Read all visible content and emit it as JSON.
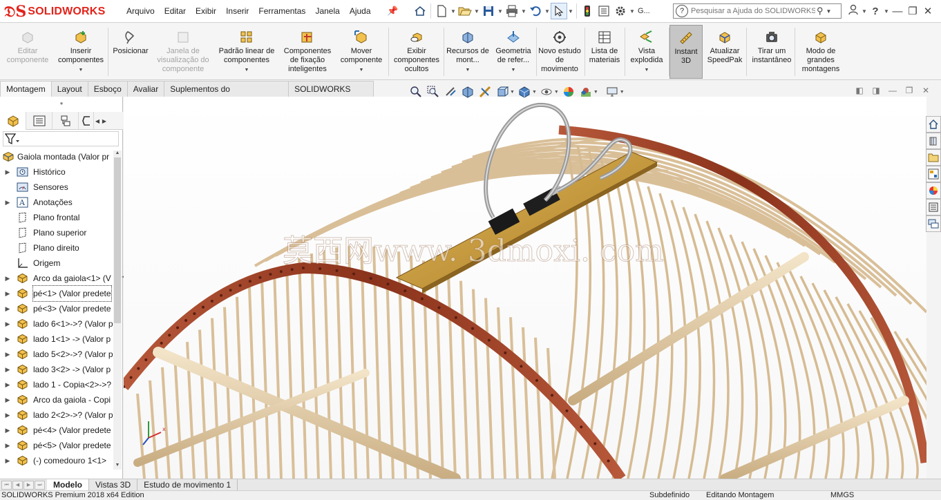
{
  "app": {
    "brand": "SOLIDWORKS",
    "accent_color": "#e2231a"
  },
  "menu": [
    "Arquivo",
    "Editar",
    "Exibir",
    "Inserir",
    "Ferramentas",
    "Janela",
    "Ajuda"
  ],
  "quick_toolbar": {
    "icons": [
      "home-icon",
      "new-doc-icon",
      "open-icon",
      "save-icon",
      "print-icon",
      "undo-icon",
      "select-icon",
      "rebuild-icon",
      "file-properties-icon",
      "options-icon"
    ],
    "options_label": "G..."
  },
  "search": {
    "placeholder": "Pesquisar a Ajuda do SOLIDWORKS"
  },
  "command_manager": [
    {
      "label": "Editar componente",
      "disabled": true,
      "dropdown": false
    },
    {
      "label": "Inserir componentes",
      "disabled": false,
      "dropdown": true
    },
    {
      "label": "Posicionar",
      "disabled": false,
      "dropdown": false
    },
    {
      "label": "Janela de visualização do componente",
      "disabled": true,
      "dropdown": false
    },
    {
      "label": "Padrão linear de componentes",
      "disabled": false,
      "dropdown": true
    },
    {
      "label": "Componentes de fixação inteligentes",
      "disabled": false,
      "dropdown": false
    },
    {
      "label": "Mover componente",
      "disabled": false,
      "dropdown": true
    },
    {
      "label": "Exibir componentes ocultos",
      "disabled": false,
      "dropdown": false
    },
    {
      "label": "Recursos de mont...",
      "disabled": false,
      "dropdown": true
    },
    {
      "label": "Geometria de refer...",
      "disabled": false,
      "dropdown": true
    },
    {
      "label": "Novo estudo de movimento",
      "disabled": false,
      "dropdown": false
    },
    {
      "label": "Lista de materiais",
      "disabled": false,
      "dropdown": false
    },
    {
      "label": "Vista explodida",
      "disabled": false,
      "dropdown": true
    },
    {
      "label": "Instant 3D",
      "disabled": false,
      "dropdown": false,
      "active": true
    },
    {
      "label": "Atualizar SpeedPak",
      "disabled": false,
      "dropdown": false
    },
    {
      "label": "Tirar um instantâneo",
      "disabled": false,
      "dropdown": false
    },
    {
      "label": "Modo de grandes montagens",
      "disabled": false,
      "dropdown": false
    }
  ],
  "tabs": [
    "Montagem",
    "Layout",
    "Esboço",
    "Avaliar",
    "Suplementos do SOLIDWORKS",
    "SOLIDWORKS MBD"
  ],
  "active_tab": "Montagem",
  "tree": {
    "root": "Gaiola montada  (Valor pr",
    "items": [
      {
        "label": "Histórico",
        "expandable": true,
        "icon": "history-icon"
      },
      {
        "label": "Sensores",
        "expandable": false,
        "icon": "sensor-icon"
      },
      {
        "label": "Anotações",
        "expandable": true,
        "icon": "annotation-icon"
      },
      {
        "label": "Plano frontal",
        "expandable": false,
        "icon": "plane-icon"
      },
      {
        "label": "Plano superior",
        "expandable": false,
        "icon": "plane-icon"
      },
      {
        "label": "Plano direito",
        "expandable": false,
        "icon": "plane-icon"
      },
      {
        "label": "Origem",
        "expandable": false,
        "icon": "origin-icon"
      },
      {
        "label": "Arco da gaiola<1> (V",
        "expandable": true,
        "icon": "part-icon"
      },
      {
        "label": "pé<1> (Valor predete",
        "expandable": true,
        "icon": "part-icon",
        "selected": true
      },
      {
        "label": "pé<3> (Valor predete",
        "expandable": true,
        "icon": "part-icon"
      },
      {
        "label": "lado 6<1>->? (Valor p",
        "expandable": true,
        "icon": "part-icon"
      },
      {
        "label": "lado 1<1> -> (Valor p",
        "expandable": true,
        "icon": "part-icon"
      },
      {
        "label": "lado 5<2>->? (Valor p",
        "expandable": true,
        "icon": "part-icon"
      },
      {
        "label": "lado 3<2> -> (Valor p",
        "expandable": true,
        "icon": "part-icon"
      },
      {
        "label": "lado 1 - Copia<2>->?",
        "expandable": true,
        "icon": "part-icon"
      },
      {
        "label": "Arco da gaiola - Copi",
        "expandable": true,
        "icon": "part-icon"
      },
      {
        "label": "lado 2<2>->? (Valor p",
        "expandable": true,
        "icon": "part-icon"
      },
      {
        "label": "pé<4> (Valor predete",
        "expandable": true,
        "icon": "part-icon"
      },
      {
        "label": "pé<5> (Valor predete",
        "expandable": true,
        "icon": "part-icon"
      },
      {
        "label": "(-) comedouro 1<1>",
        "expandable": true,
        "icon": "part-icon"
      }
    ]
  },
  "watermark": "莫西网www. 3dmoxi. com",
  "bottom_tabs": [
    "Modelo",
    "Vistas 3D",
    "Estudo de movimento 1"
  ],
  "active_bottom_tab": "Modelo",
  "status": {
    "edition": "SOLIDWORKS Premium 2018 x64 Edition",
    "state": "Subdefinido",
    "mode": "Editando Montagem",
    "units": "MMGS"
  },
  "colors": {
    "wood_light": "#e3ccaa",
    "hoop": "#9a3d22",
    "plank": "#c99c3a",
    "handle": "#a8a8a8"
  }
}
